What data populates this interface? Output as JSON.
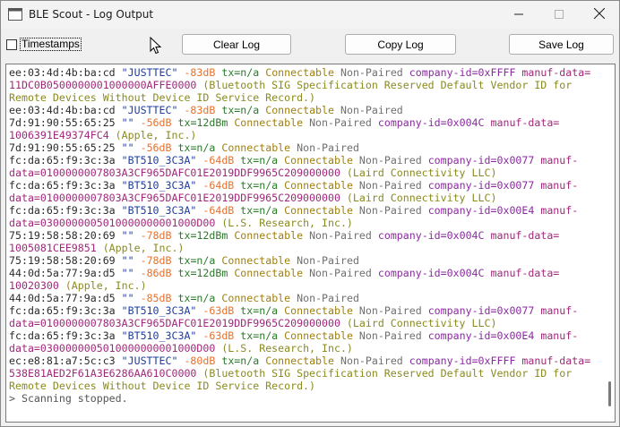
{
  "window": {
    "title": "BLE Scout - Log Output"
  },
  "toolbar": {
    "timestamps_label": "Timestamps",
    "clear_label": "Clear Log",
    "copy_label": "Copy Log",
    "save_label": "Save Log"
  },
  "log": {
    "lines": [
      [
        {
          "c": "mac",
          "t": "ee:03:4d:4b:ba:cd "
        },
        {
          "c": "name",
          "t": "\"JUSTTEC\" "
        },
        {
          "c": "rssi",
          "t": "-83dB "
        },
        {
          "c": "tx",
          "t": "tx=n/a "
        },
        {
          "c": "conn",
          "t": "Connectable "
        },
        {
          "c": "pair",
          "t": "Non-Paired "
        },
        {
          "c": "cid",
          "t": "company-id=0xFFFF "
        },
        {
          "c": "manuf",
          "t": "manuf-data="
        }
      ],
      [
        {
          "c": "manuf",
          "t": "11DC0B0500000001000000AFFE0000 "
        },
        {
          "c": "vendor",
          "t": "(Bluetooth SIG Specification Reserved Default Vendor ID for"
        }
      ],
      [
        {
          "c": "vendor",
          "t": "Remote Devices Without Device ID Service Record.)"
        }
      ],
      [
        {
          "c": "mac",
          "t": "ee:03:4d:4b:ba:cd "
        },
        {
          "c": "name",
          "t": "\"JUSTTEC\" "
        },
        {
          "c": "rssi",
          "t": "-83dB "
        },
        {
          "c": "tx",
          "t": "tx=n/a "
        },
        {
          "c": "conn",
          "t": "Connectable "
        },
        {
          "c": "pair",
          "t": "Non-Paired"
        }
      ],
      [
        {
          "c": "mac",
          "t": "7d:91:90:55:65:25 "
        },
        {
          "c": "name",
          "t": "\"\" "
        },
        {
          "c": "rssi",
          "t": "-56dB "
        },
        {
          "c": "tx",
          "t": "tx=12dBm "
        },
        {
          "c": "conn",
          "t": "Connectable "
        },
        {
          "c": "pair",
          "t": "Non-Paired "
        },
        {
          "c": "cid",
          "t": "company-id=0x004C "
        },
        {
          "c": "manuf",
          "t": "manuf-data="
        }
      ],
      [
        {
          "c": "manuf",
          "t": "1006391E49374FC4 "
        },
        {
          "c": "vendor",
          "t": "(Apple, Inc.)"
        }
      ],
      [
        {
          "c": "mac",
          "t": "7d:91:90:55:65:25 "
        },
        {
          "c": "name",
          "t": "\"\" "
        },
        {
          "c": "rssi",
          "t": "-56dB "
        },
        {
          "c": "tx",
          "t": "tx=n/a "
        },
        {
          "c": "conn",
          "t": "Connectable "
        },
        {
          "c": "pair",
          "t": "Non-Paired"
        }
      ],
      [
        {
          "c": "mac",
          "t": "fc:da:65:f9:3c:3a "
        },
        {
          "c": "name",
          "t": "\"BT510_3C3A\" "
        },
        {
          "c": "rssi",
          "t": "-64dB "
        },
        {
          "c": "tx",
          "t": "tx=n/a "
        },
        {
          "c": "conn",
          "t": "Connectable "
        },
        {
          "c": "pair",
          "t": "Non-Paired "
        },
        {
          "c": "cid",
          "t": "company-id=0x0077 "
        },
        {
          "c": "manuf",
          "t": "manuf-"
        }
      ],
      [
        {
          "c": "manuf",
          "t": "data=0100000007803A3CF965DAFC01E2019DDF9965C209000000 "
        },
        {
          "c": "vendor",
          "t": "(Laird Connectivity LLC)"
        }
      ],
      [
        {
          "c": "mac",
          "t": "fc:da:65:f9:3c:3a "
        },
        {
          "c": "name",
          "t": "\"BT510_3C3A\" "
        },
        {
          "c": "rssi",
          "t": "-64dB "
        },
        {
          "c": "tx",
          "t": "tx=n/a "
        },
        {
          "c": "conn",
          "t": "Connectable "
        },
        {
          "c": "pair",
          "t": "Non-Paired "
        },
        {
          "c": "cid",
          "t": "company-id=0x0077 "
        },
        {
          "c": "manuf",
          "t": "manuf-"
        }
      ],
      [
        {
          "c": "manuf",
          "t": "data=0100000007803A3CF965DAFC01E2019DDF9965C209000000 "
        },
        {
          "c": "vendor",
          "t": "(Laird Connectivity LLC)"
        }
      ],
      [
        {
          "c": "mac",
          "t": "fc:da:65:f9:3c:3a "
        },
        {
          "c": "name",
          "t": "\"BT510_3C3A\" "
        },
        {
          "c": "rssi",
          "t": "-64dB "
        },
        {
          "c": "tx",
          "t": "tx=n/a "
        },
        {
          "c": "conn",
          "t": "Connectable "
        },
        {
          "c": "pair",
          "t": "Non-Paired "
        },
        {
          "c": "cid",
          "t": "company-id=0x00E4 "
        },
        {
          "c": "manuf",
          "t": "manuf-"
        }
      ],
      [
        {
          "c": "manuf",
          "t": "data=0300000005010000000001000D00 "
        },
        {
          "c": "vendor",
          "t": "(L.S. Research, Inc.)"
        }
      ],
      [
        {
          "c": "mac",
          "t": "75:19:58:58:20:69 "
        },
        {
          "c": "name",
          "t": "\"\" "
        },
        {
          "c": "rssi",
          "t": "-78dB "
        },
        {
          "c": "tx",
          "t": "tx=12dBm "
        },
        {
          "c": "conn",
          "t": "Connectable "
        },
        {
          "c": "pair",
          "t": "Non-Paired "
        },
        {
          "c": "cid",
          "t": "company-id=0x004C "
        },
        {
          "c": "manuf",
          "t": "manuf-data="
        }
      ],
      [
        {
          "c": "manuf",
          "t": "1005081CEE9851 "
        },
        {
          "c": "vendor",
          "t": "(Apple, Inc.)"
        }
      ],
      [
        {
          "c": "mac",
          "t": "75:19:58:58:20:69 "
        },
        {
          "c": "name",
          "t": "\"\" "
        },
        {
          "c": "rssi",
          "t": "-78dB "
        },
        {
          "c": "tx",
          "t": "tx=n/a "
        },
        {
          "c": "conn",
          "t": "Connectable "
        },
        {
          "c": "pair",
          "t": "Non-Paired"
        }
      ],
      [
        {
          "c": "mac",
          "t": "44:0d:5a:77:9a:d5 "
        },
        {
          "c": "name",
          "t": "\"\" "
        },
        {
          "c": "rssi",
          "t": "-86dB "
        },
        {
          "c": "tx",
          "t": "tx=12dBm "
        },
        {
          "c": "conn",
          "t": "Connectable "
        },
        {
          "c": "pair",
          "t": "Non-Paired "
        },
        {
          "c": "cid",
          "t": "company-id=0x004C "
        },
        {
          "c": "manuf",
          "t": "manuf-data="
        }
      ],
      [
        {
          "c": "manuf",
          "t": "10020300 "
        },
        {
          "c": "vendor",
          "t": "(Apple, Inc.)"
        }
      ],
      [
        {
          "c": "mac",
          "t": "44:0d:5a:77:9a:d5 "
        },
        {
          "c": "name",
          "t": "\"\" "
        },
        {
          "c": "rssi",
          "t": "-85dB "
        },
        {
          "c": "tx",
          "t": "tx=n/a "
        },
        {
          "c": "conn",
          "t": "Connectable "
        },
        {
          "c": "pair",
          "t": "Non-Paired"
        }
      ],
      [
        {
          "c": "mac",
          "t": "fc:da:65:f9:3c:3a "
        },
        {
          "c": "name",
          "t": "\"BT510_3C3A\" "
        },
        {
          "c": "rssi",
          "t": "-63dB "
        },
        {
          "c": "tx",
          "t": "tx=n/a "
        },
        {
          "c": "conn",
          "t": "Connectable "
        },
        {
          "c": "pair",
          "t": "Non-Paired "
        },
        {
          "c": "cid",
          "t": "company-id=0x0077 "
        },
        {
          "c": "manuf",
          "t": "manuf-"
        }
      ],
      [
        {
          "c": "manuf",
          "t": "data=0100000007803A3CF965DAFC01E2019DDF9965C209000000 "
        },
        {
          "c": "vendor",
          "t": "(Laird Connectivity LLC)"
        }
      ],
      [
        {
          "c": "mac",
          "t": "fc:da:65:f9:3c:3a "
        },
        {
          "c": "name",
          "t": "\"BT510_3C3A\" "
        },
        {
          "c": "rssi",
          "t": "-63dB "
        },
        {
          "c": "tx",
          "t": "tx=n/a "
        },
        {
          "c": "conn",
          "t": "Connectable "
        },
        {
          "c": "pair",
          "t": "Non-Paired "
        },
        {
          "c": "cid",
          "t": "company-id=0x00E4 "
        },
        {
          "c": "manuf",
          "t": "manuf-"
        }
      ],
      [
        {
          "c": "manuf",
          "t": "data=0300000005010000000001000D00 "
        },
        {
          "c": "vendor",
          "t": "(L.S. Research, Inc.)"
        }
      ],
      [
        {
          "c": "mac",
          "t": "ec:e8:81:a7:5c:c3 "
        },
        {
          "c": "name",
          "t": "\"JUSTTEC\" "
        },
        {
          "c": "rssi",
          "t": "-80dB "
        },
        {
          "c": "tx",
          "t": "tx=n/a "
        },
        {
          "c": "conn",
          "t": "Connectable "
        },
        {
          "c": "pair",
          "t": "Non-Paired "
        },
        {
          "c": "cid",
          "t": "company-id=0xFFFF "
        },
        {
          "c": "manuf",
          "t": "manuf-data="
        }
      ],
      [
        {
          "c": "manuf",
          "t": "538E81AED2F61A3E6286AA610C0000 "
        },
        {
          "c": "vendor",
          "t": "(Bluetooth SIG Specification Reserved Default Vendor ID for"
        }
      ],
      [
        {
          "c": "vendor",
          "t": "Remote Devices Without Device ID Service Record.)"
        }
      ],
      [
        {
          "c": "prompt",
          "t": "> Scanning stopped."
        }
      ]
    ]
  },
  "colors": {
    "mac": "#2b2b2b",
    "name": "#1e3ca0",
    "rssi": "#e8702a",
    "tx": "#2a7a2a",
    "connectable": "#a08010",
    "paired": "#707070",
    "company_id": "#8a2aa0",
    "manuf_data": "#a0287a",
    "vendor": "#8a8a20"
  }
}
